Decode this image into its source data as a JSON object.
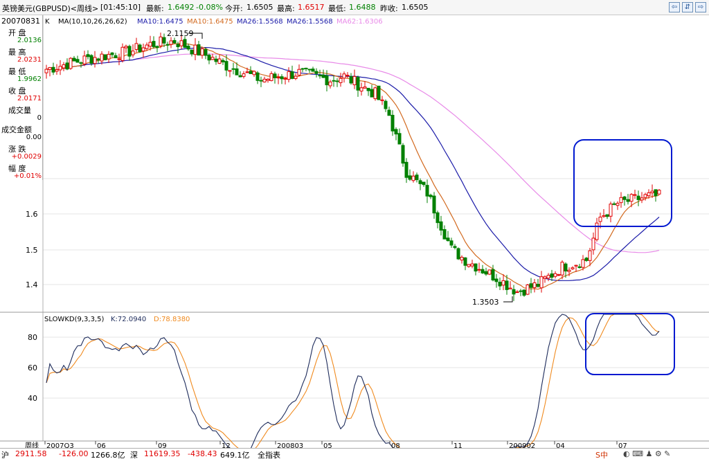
{
  "header": {
    "pair_label": "英镑美元(GBPUSD)<周线>",
    "time": "[01:45:10]",
    "latest_label": "最新:",
    "latest_value": "1.6492",
    "change": "-0.08%",
    "open_label": "今开:",
    "open_value": "1.6505",
    "high_label": "最高:",
    "high_value": "1.6517",
    "low_label": "最低:",
    "low_value": "1.6488",
    "prev_close_label": "昨收:",
    "prev_close_value": "1.6505"
  },
  "info_panel": {
    "date": "20070831",
    "open_label": "开  盘",
    "open_value": "2.0136",
    "high_label": "最  高",
    "high_value": "2.0231",
    "low_label": "最  低",
    "low_value": "1.9962",
    "close_label": "收  盘",
    "close_value": "2.0171",
    "volume_label": "成交量",
    "volume_value": "0",
    "amount_label": "成交金额",
    "amount_value": "0.00",
    "change_label": "涨  跌",
    "change_value": "+0.0029",
    "pct_label": "幅  度",
    "pct_value": "+0.01%"
  },
  "main_chart": {
    "k_label": "K",
    "ma_params": "MA(10,10,26,26,62)",
    "ma10a": "MA10:1.6475",
    "ma10b": "MA10:1.6475",
    "ma26a": "MA26:1.5568",
    "ma26b": "MA26:1.5568",
    "ma62": "MA62:1.6306",
    "max_annotation": "2.1159",
    "min_annotation": "1.3503",
    "y_ticks": [
      "1.6",
      "1.5",
      "1.4"
    ]
  },
  "indicator": {
    "name": "SLOWKD(9,3,3,5)",
    "k": "K:72.0940",
    "d": "D:78.8380",
    "y_ticks": [
      "80",
      "60",
      "40"
    ]
  },
  "x_axis": {
    "period_label": "周线",
    "ticks": [
      "2007Q3",
      "06",
      "09",
      "12",
      "200803",
      "05",
      "08",
      "11",
      "200902",
      "04",
      "07"
    ]
  },
  "status_bar": {
    "sh_label": "沪",
    "sh_value": "2911.58",
    "sh_change": "-126.00",
    "sh_amount": "1266.8亿",
    "sz_label": "深",
    "sz_value": "11619.35",
    "sz_change": "-438.43",
    "sz_amount": "649.1亿",
    "extra": "全指表"
  },
  "colors": {
    "up": "#e00000",
    "down": "#008000",
    "ma10": "#d2691e",
    "ma26": "#1a1aa8",
    "ma62": "#e88ae8",
    "k_line": "#1c2a5a",
    "d_line": "#f08a1e",
    "highlight_box": "#0018d0"
  }
}
